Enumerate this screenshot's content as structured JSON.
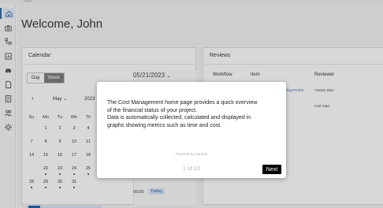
{
  "page": {
    "welcome": "Welcome, John"
  },
  "sidebar": {
    "items": [
      {
        "icon": "home-icon",
        "active": true
      },
      {
        "icon": "camera-icon",
        "active": false
      },
      {
        "icon": "tree-icon",
        "active": false
      },
      {
        "icon": "chart-icon",
        "active": false
      },
      {
        "icon": "car-icon",
        "active": false
      },
      {
        "icon": "document-icon",
        "active": false
      },
      {
        "icon": "form-icon",
        "active": false
      },
      {
        "icon": "people-icon",
        "active": false
      },
      {
        "icon": "gear-icon",
        "active": false
      }
    ]
  },
  "calendar": {
    "title": "Calendar",
    "day_label": "Day",
    "week_label": "Week",
    "prev_glyph": "‹",
    "month": "May",
    "year": "2023",
    "dropdown_glyph": "⌄",
    "weekdays": [
      "Su",
      "Mo",
      "Tu",
      "We",
      "Th",
      "Fr",
      "Sa"
    ],
    "weeks": [
      [
        "",
        "1",
        "2",
        "3",
        "4",
        "5",
        "6"
      ],
      [
        "7",
        "8",
        "9",
        "10",
        "11",
        "12",
        "13"
      ],
      [
        "14",
        "15",
        "16",
        "17",
        "18",
        "19",
        "20"
      ],
      [
        "21",
        "22",
        "23",
        "24",
        "25",
        "26",
        "27"
      ],
      [
        "28",
        "29",
        "30",
        "31",
        "",
        "",
        ""
      ]
    ],
    "selected_date": "05/21/2023",
    "date_glyph": "⌄",
    "footer_date": "05/26",
    "today_label": "Today"
  },
  "reviews": {
    "title": "Reviews",
    "columns": [
      "Workflow",
      "Item",
      "Reviewer"
    ],
    "rows": [
      {
        "item": "ding-PA003",
        "reviewer": "Yvetzin Diaz"
      },
      {
        "item": "",
        "reviewer": "Carl Clad"
      }
    ]
  },
  "tour": {
    "line1": "The Cost Management home page provides a quick overview",
    "line2": "of the financial status of your project.",
    "line3": "Data is automatically collected, calculated and displayed in",
    "line4": "graphs showing metrics such as time and cost.",
    "powered": "Powered by Kanaria",
    "pager": "1 of 13",
    "next_label": "Next"
  },
  "colors": {
    "accent": "#1f5ea8",
    "week_band": "#d7e4f2",
    "next_button": "#000000"
  }
}
